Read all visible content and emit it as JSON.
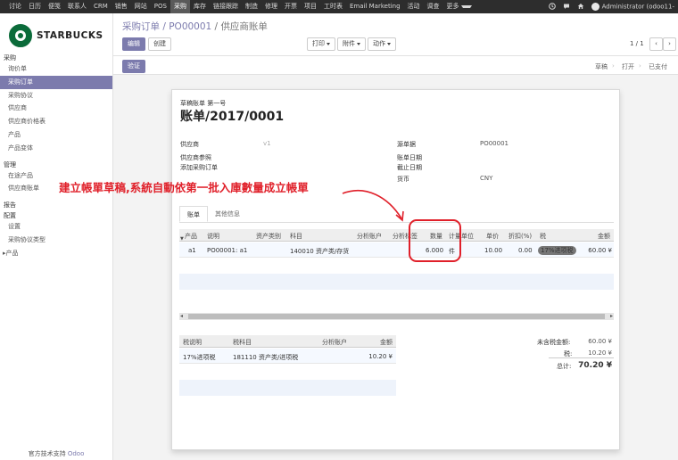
{
  "topbar": {
    "menu": [
      "讨论",
      "日历",
      "便笺",
      "联系人",
      "CRM",
      "销售",
      "网站",
      "POS",
      "采购",
      "库存",
      "链接跟踪",
      "制造",
      "修理",
      "开票",
      "项目",
      "工时表",
      "Email Marketing",
      "活动",
      "调查",
      "更多"
    ],
    "active": "采购",
    "user": "Administrator (odoo11-"
  },
  "sidebar": {
    "brand": "STARBUCKS",
    "sections": [
      {
        "label": "采购",
        "items": [
          "询价单",
          "采购订单",
          "采购协议",
          "供应商",
          "供应商价格表",
          "产品",
          "产品变体"
        ]
      },
      {
        "label": "管理",
        "items": [
          "在途产品",
          "供应商账单"
        ]
      },
      {
        "label": "报告",
        "items": []
      },
      {
        "label": "配置",
        "items": [
          "设置",
          "采购协议类型",
          "产品"
        ]
      }
    ],
    "active_item": "采购订单",
    "powered_prefix": "官方技术支持 ",
    "powered_brand": "Odoo"
  },
  "breadcrumb": {
    "part1": "采购订单",
    "sep1": " / ",
    "part2": "PO00001",
    "sep2": " / ",
    "current": "供应商账单"
  },
  "buttons": {
    "edit": "编辑",
    "create": "创建",
    "print": "打印",
    "attach": "附件",
    "action": "动作",
    "validate": "验证"
  },
  "pager": {
    "text": "1 / 1",
    "prev": "‹",
    "next": "›"
  },
  "statusbar": [
    "草稿",
    "打开",
    "已支付"
  ],
  "sheet": {
    "subtitle": "草稿账单 第一号",
    "title": "账单/2017/0001",
    "fields_left": [
      {
        "label": "供应商",
        "value": "v1"
      },
      {
        "label": "供应商参照",
        "value": ""
      },
      {
        "label": "添加采购订单",
        "value": ""
      }
    ],
    "fields_right": [
      {
        "label": "源单据",
        "value": "PO00001"
      },
      {
        "label": "账单日期",
        "value": ""
      },
      {
        "label": "截止日期",
        "value": ""
      },
      {
        "label": "货币",
        "value": "CNY"
      }
    ],
    "tabs": [
      "账单",
      "其他信息"
    ],
    "line_headers": [
      "产品",
      "说明",
      "资产类别",
      "科目",
      "分析账户",
      "分析标签",
      "数量",
      "计量单位",
      "单价",
      "折扣(%)",
      "税",
      "金额"
    ],
    "line": {
      "product": "a1",
      "description": "PO00001: a1",
      "account": "140010 资产类/存货",
      "qty": "6.000",
      "uom": "件",
      "price": "10.00",
      "discount": "0.00",
      "tax": "17%进项税",
      "amount": "60.00 ¥"
    },
    "tax_headers": [
      "税说明",
      "税科目",
      "分析账户",
      "金额"
    ],
    "tax_line": {
      "desc": "17%进项税",
      "account": "181110 资产类/进项税",
      "amount": "10.20 ¥"
    },
    "totals": [
      {
        "label": "未含税金额:",
        "value": "60.00 ¥"
      },
      {
        "label": "税:",
        "value": "10.20 ¥"
      },
      {
        "label": "总计:",
        "value": "70.20 ¥"
      }
    ]
  },
  "annotation": "建立帳單草稿,系統自動依第一批入庫數量成立帳單",
  "colors": {
    "accent": "#7c7bad",
    "annotation": "#e0202a",
    "topbar": "#2d2d2d"
  }
}
